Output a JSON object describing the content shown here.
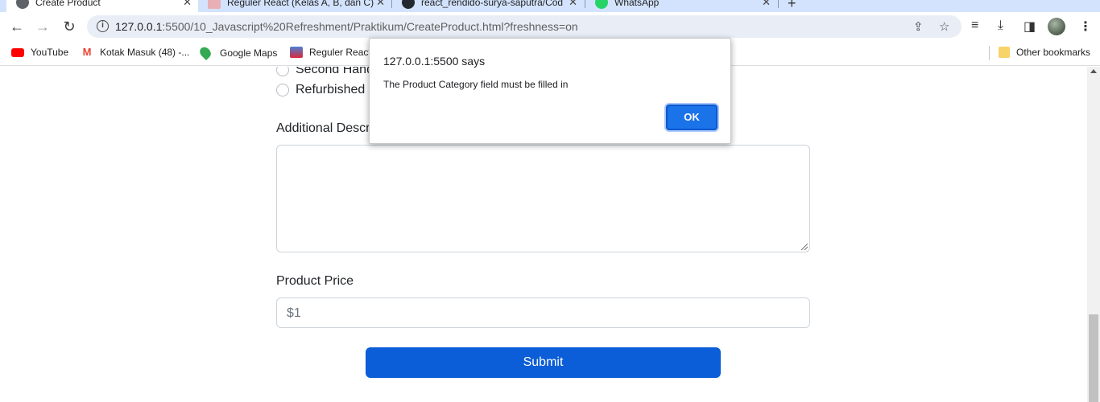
{
  "browser": {
    "tabs": [
      {
        "title": "Create Product",
        "active": true
      },
      {
        "title": "Reguler React (Kelas A, B, dan C)",
        "active": false
      },
      {
        "title": "react_rendido-surya-saputra/Cod",
        "active": false
      },
      {
        "title": "WhatsApp",
        "active": false
      }
    ],
    "url_host": "127.0.0.1",
    "url_rest": ":5500/10_Javascript%20Refreshment/Praktikum/CreateProduct.html?freshness=on",
    "bookmarks": [
      {
        "label": "YouTube",
        "icon": "youtube-icon"
      },
      {
        "label": "Kotak Masuk (48) -...",
        "icon": "gmail-icon"
      },
      {
        "label": "Google Maps",
        "icon": "maps-icon"
      },
      {
        "label": "Reguler React",
        "icon": "bookmark-site-icon"
      }
    ],
    "other_bookmarks": "Other bookmarks"
  },
  "form": {
    "radio_options": [
      "Second Hand",
      "Refurbished"
    ],
    "description_label": "Additional Description",
    "price_label": "Product Price",
    "price_placeholder": "$1",
    "submit_label": "Submit"
  },
  "dialog": {
    "title": "127.0.0.1:5500 says",
    "message": "The Product Category field must be filled in",
    "ok_label": "OK"
  },
  "colors": {
    "primary": "#0b5ed7",
    "dialog_button": "#1a73e8",
    "tabstrip": "#d3e3fd"
  }
}
